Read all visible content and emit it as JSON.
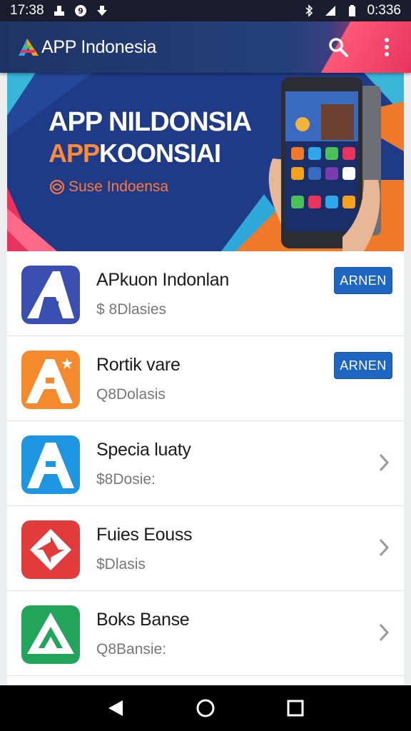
{
  "status": {
    "time": "17:38",
    "battery_time": "0:336",
    "left_icons": [
      "terminal-icon",
      "notification-circle-icon",
      "download-icon"
    ],
    "right_icons": [
      "bluetooth-icon",
      "signal-icon",
      "battery-icon"
    ]
  },
  "app_bar": {
    "title": "APP Indonesia",
    "search_icon": "search-icon",
    "menu_icon": "more-vert-icon"
  },
  "banner": {
    "title1": "APP NILDONSIA",
    "title2_accent": "APP",
    "title2_rest": "KOONSIAI",
    "subtitle": "Suse Indoensa"
  },
  "apps": [
    {
      "name": "APkuon Indonlan",
      "meta": "$ 8Dlasies",
      "action": "ARNEN",
      "icon_color": "#3a4fb0",
      "icon": "letter-a-icon"
    },
    {
      "name": "Rortik vare",
      "meta": "Q8Dolasis",
      "action": "ARNEN",
      "icon_color": "#f58a2c",
      "icon": "letter-a-star-icon"
    },
    {
      "name": "Specia luaty",
      "meta": "$8Dosie:",
      "action": "",
      "icon_color": "#1e95e0",
      "icon": "letter-a-icon"
    },
    {
      "name": "Fuies Eouss",
      "meta": "$Dlasis",
      "action": "",
      "icon_color": "#e23b3b",
      "icon": "pinwheel-icon"
    },
    {
      "name": "Boks Banse",
      "meta": "Q8Bansie:",
      "action": "",
      "icon_color": "#22a55a",
      "icon": "recycle-triangle-icon"
    }
  ],
  "nav": {
    "back": "back-icon",
    "home": "home-icon",
    "recents": "recents-icon"
  }
}
